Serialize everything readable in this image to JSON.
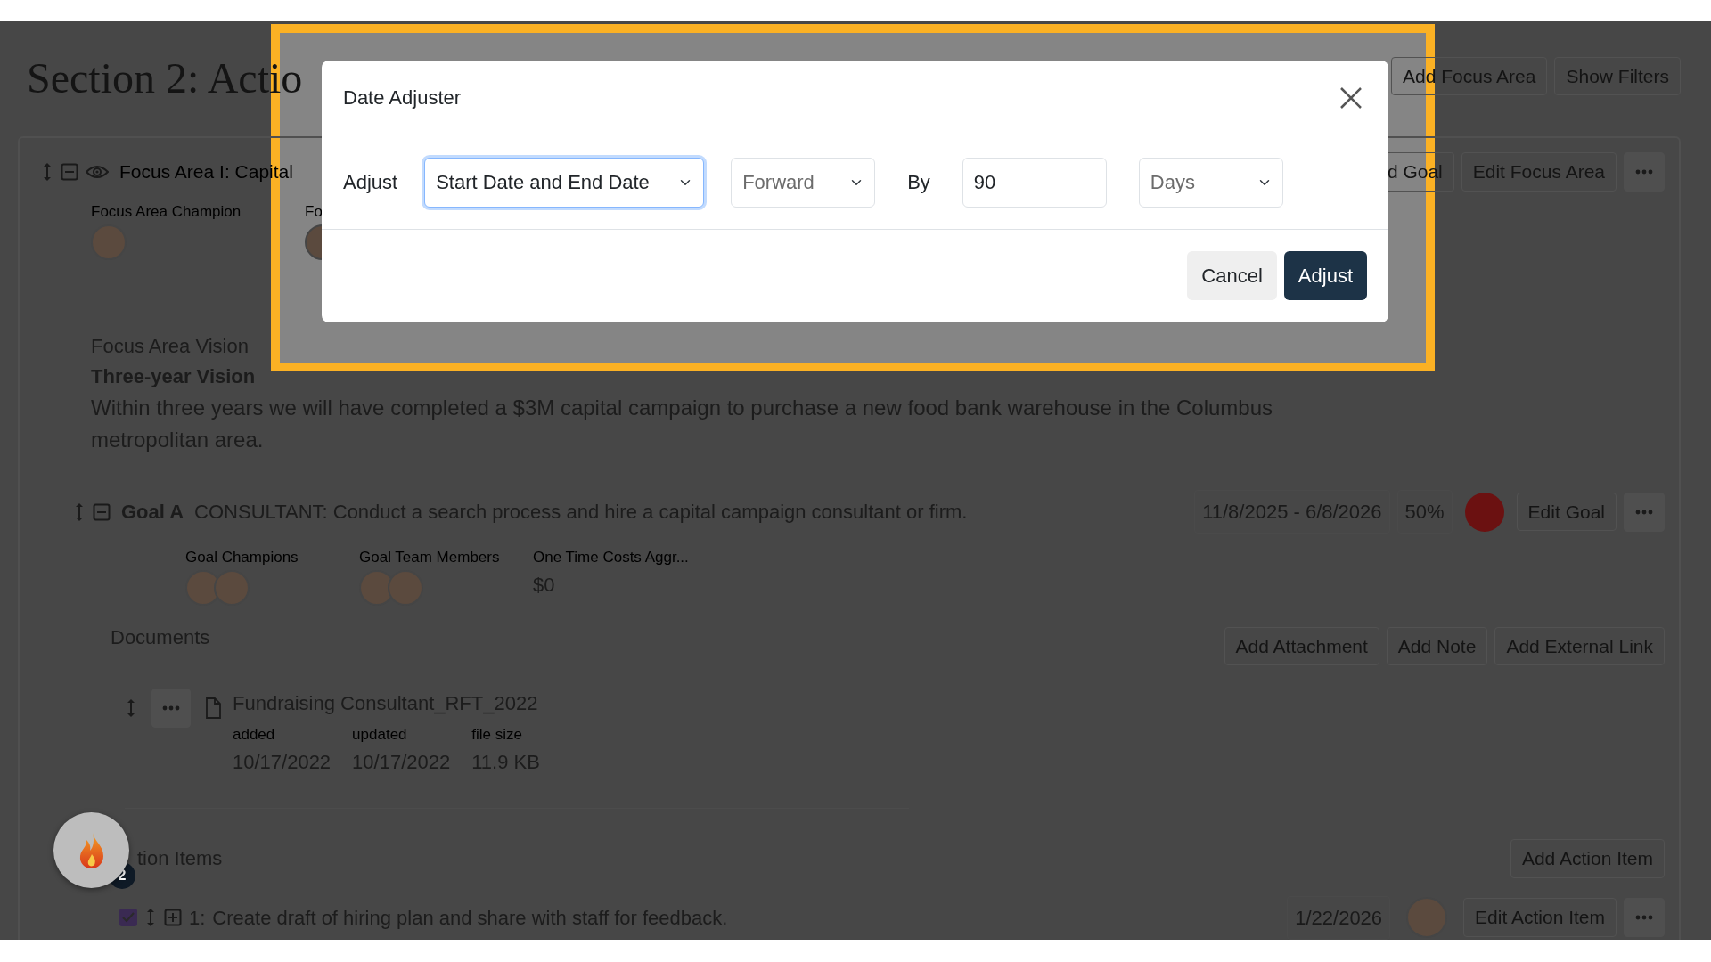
{
  "page": {
    "title": "Section 2: Actio",
    "header_buttons": [
      "Add Focus Area",
      "Show Filters"
    ]
  },
  "focus_area": {
    "title": "Focus Area I: Capital",
    "buttons": [
      "d Goal",
      "Edit Focus Area"
    ],
    "fields": [
      {
        "label": "Focus Area Champion",
        "avatars": [
          {
            "kind": "photo"
          }
        ]
      },
      {
        "label": "Fo",
        "avatars": [
          {
            "kind": "photo"
          }
        ]
      }
    ],
    "vision_label": "Focus Area Vision",
    "vision_heading": "Three-year Vision",
    "vision_text": "Within three years we will have completed a $3M capital campaign to purchase a new food bank warehouse in the Columbus metropolitan area."
  },
  "goal": {
    "label": "Goal A",
    "text": "CONSULTANT: Conduct a search process and hire a capital campaign consultant or firm.",
    "dates": "11/8/2025 - 6/8/2026",
    "progress": "50%",
    "color": "#6b1111",
    "edit": "Edit Goal",
    "fields": [
      {
        "label": "Goal Champions",
        "avatars": [
          {
            "kind": "photo"
          },
          {
            "kind": "photo"
          }
        ]
      },
      {
        "label": "Goal Team Members",
        "avatars": [
          {
            "kind": "photo"
          },
          {
            "kind": "photo"
          }
        ]
      },
      {
        "label": "One Time Costs Aggr...",
        "value": "$0"
      }
    ]
  },
  "documents": {
    "title": "Documents",
    "buttons": [
      "Add Attachment",
      "Add Note",
      "Add External Link"
    ],
    "files": [
      {
        "name": "Fundraising Consultant_RFT_2022",
        "meta": [
          {
            "label": "added",
            "value": "10/17/2022"
          },
          {
            "label": "updated",
            "value": "10/17/2022"
          },
          {
            "label": "file size",
            "value": "11.9 KB"
          }
        ]
      }
    ]
  },
  "action_items": {
    "title": "tion Items",
    "add": "Add Action Item",
    "items": [
      {
        "checked": true,
        "number": "1:",
        "text": "Create draft of hiring plan and share with staff for feedback.",
        "date": "1/22/2026",
        "edit": "Edit Action Item",
        "avatars": [
          {
            "kind": "photo"
          }
        ]
      }
    ]
  },
  "notification": {
    "count": "2"
  },
  "modal": {
    "title": "Date Adjuster",
    "adjust_label": "Adjust",
    "scope": "Start Date and End Date",
    "direction": "Forward",
    "by_label": "By",
    "amount": "90",
    "unit": "Days",
    "buttons": [
      {
        "label": "Cancel",
        "kind": "secondary"
      },
      {
        "label": "Adjust",
        "kind": "primary"
      }
    ]
  }
}
